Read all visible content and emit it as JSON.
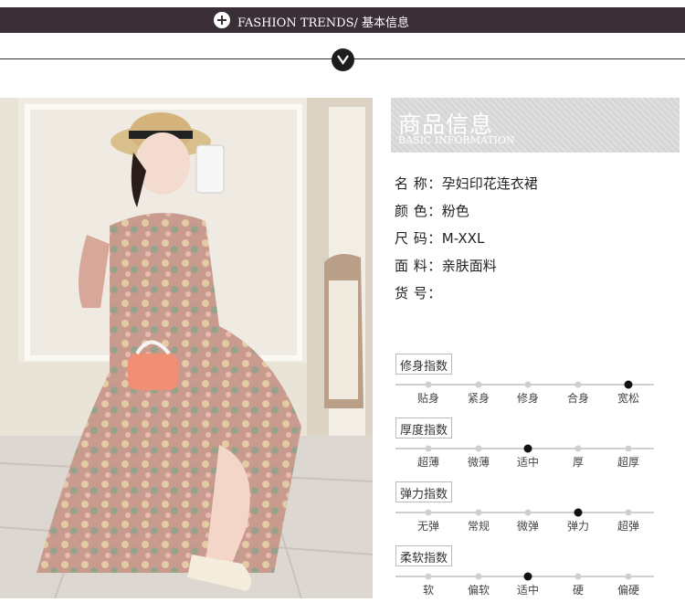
{
  "header": {
    "title": "FASHION TRENDS/ 基本信息",
    "icons": [
      "plus-circle-icon",
      "chevron-down-circle-icon"
    ]
  },
  "info": {
    "title_cn": "商品信息",
    "title_en": "BASIC INFORMATION",
    "specs": [
      {
        "key": "名 称：",
        "value": "孕妇印花连衣裙"
      },
      {
        "key": "颜 色：",
        "value": "粉色"
      },
      {
        "key": "尺 码：",
        "value": "M-XXL"
      },
      {
        "key": "面 料：",
        "value": "亲肤面料"
      },
      {
        "key": "货 号：",
        "value": ""
      }
    ]
  },
  "scales": [
    {
      "label": "修身指数",
      "ticks": [
        "贴身",
        "紧身",
        "修身",
        "合身",
        "宽松"
      ],
      "selected": 4
    },
    {
      "label": "厚度指数",
      "ticks": [
        "超薄",
        "微薄",
        "适中",
        "厚",
        "超厚"
      ],
      "selected": 2
    },
    {
      "label": "弹力指数",
      "ticks": [
        "无弹",
        "常规",
        "微弹",
        "弹力",
        "超弹"
      ],
      "selected": 3
    },
    {
      "label": "柔软指数",
      "ticks": [
        "软",
        "偏软",
        "适中",
        "硬",
        "偏硬"
      ],
      "selected": 2
    }
  ],
  "colors": {
    "header_bg": "#3a2f36",
    "selected_dot": "#111111",
    "dot": "#cfcfcf"
  }
}
